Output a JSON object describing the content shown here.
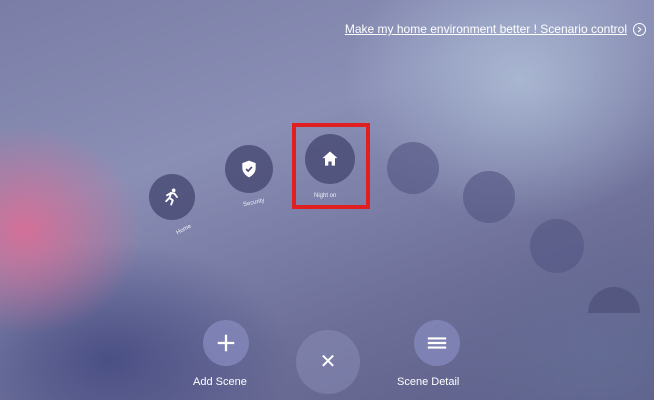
{
  "header": {
    "link_text": "Make my home environment better ! Scenario control",
    "info_icon": "chevron-right-circle-icon"
  },
  "scenes": [
    {
      "label": "Home",
      "icon": "running-person-icon"
    },
    {
      "label": "Security",
      "icon": "shield-check-icon"
    },
    {
      "label": "Night on",
      "icon": "home-icon",
      "selected": true
    }
  ],
  "actions": {
    "add_label": "Add Scene",
    "close_symbol": "✕",
    "detail_label": "Scene Detail"
  },
  "colors": {
    "highlight": "#e02020",
    "scene_circle": "#4a4c76"
  }
}
